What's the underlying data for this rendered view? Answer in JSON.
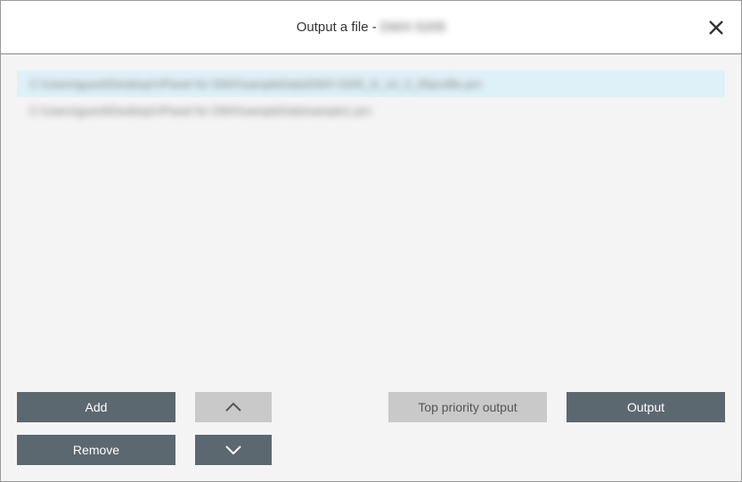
{
  "title": {
    "prefix": "Output a file - ",
    "suffix": "DWX-5205"
  },
  "list": {
    "items": [
      {
        "path": "C:\\Users\\guest\\Desktop\\VPanel for DWX\\sampleData\\DWX-5205_D_14_5_05profile.prn",
        "selected": true
      },
      {
        "path": "C:\\Users\\guest\\Desktop\\VPanel for DWX\\sampleData\\sample1.prn",
        "selected": false
      }
    ]
  },
  "buttons": {
    "add": "Add",
    "remove": "Remove",
    "top_priority": "Top priority output",
    "output": "Output"
  },
  "icons": {
    "close": "close-icon",
    "up": "chevron-up-icon",
    "down": "chevron-down-icon"
  }
}
